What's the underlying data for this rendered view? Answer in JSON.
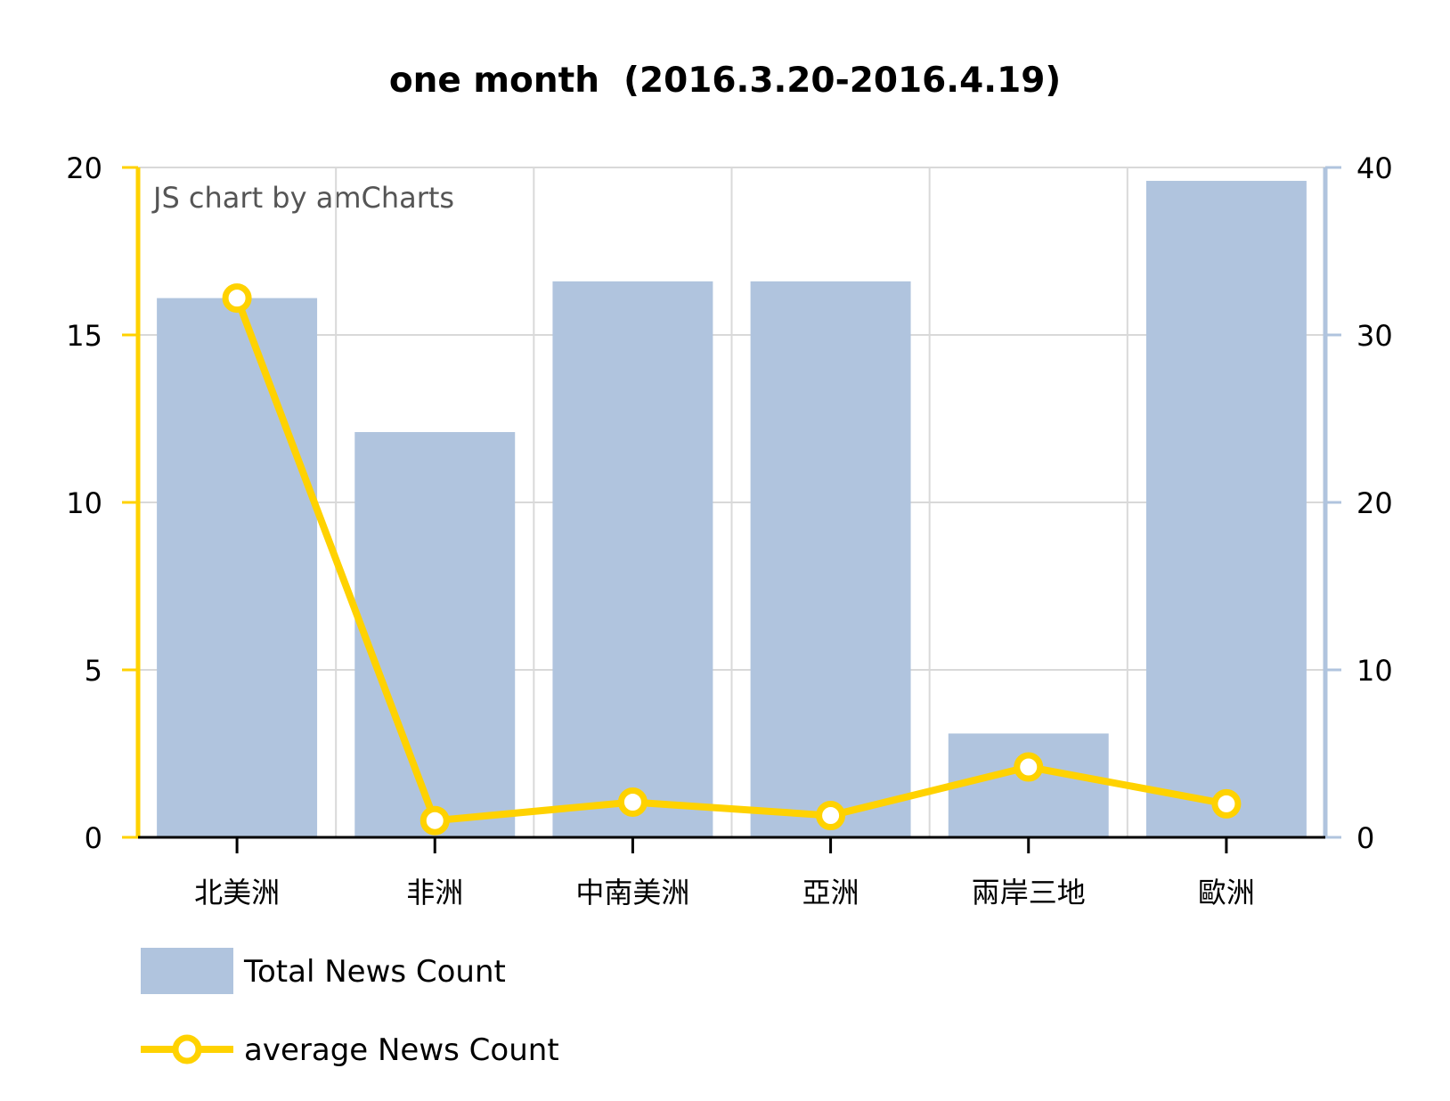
{
  "chart_data": {
    "type": "bar",
    "title": "one month  (2016.3.20-2016.4.19)",
    "watermark": "JS chart by amCharts",
    "categories": [
      "北美洲",
      "非洲",
      "中南美洲",
      "亞洲",
      "兩岸三地",
      "歐洲"
    ],
    "series": [
      {
        "name": "Total News Count",
        "type": "bar",
        "axis": "left",
        "color": "#b0c4de",
        "values": [
          16.1,
          12.1,
          16.6,
          16.6,
          3.1,
          19.6
        ]
      },
      {
        "name": "average News Count",
        "type": "line",
        "axis": "right",
        "color": "#ffd200",
        "values": [
          32.2,
          1.0,
          2.1,
          1.3,
          4.2,
          2.0
        ]
      }
    ],
    "left_axis": {
      "min": 0,
      "max": 20,
      "ticks": [
        0,
        5,
        10,
        15,
        20
      ],
      "tick_labels": [
        "0",
        "5",
        "10",
        "15",
        "20"
      ],
      "color": "#ffd200"
    },
    "right_axis": {
      "min": 0,
      "max": 40,
      "ticks": [
        0,
        10,
        20,
        30,
        40
      ],
      "tick_labels": [
        "0",
        "10",
        "20",
        "30",
        "40"
      ],
      "color": "#b0c4de"
    },
    "grid": true,
    "legend_position": "bottom-left",
    "legend": [
      {
        "label": "Total News Count",
        "marker": "bar"
      },
      {
        "label": "average News Count",
        "marker": "line"
      }
    ]
  }
}
